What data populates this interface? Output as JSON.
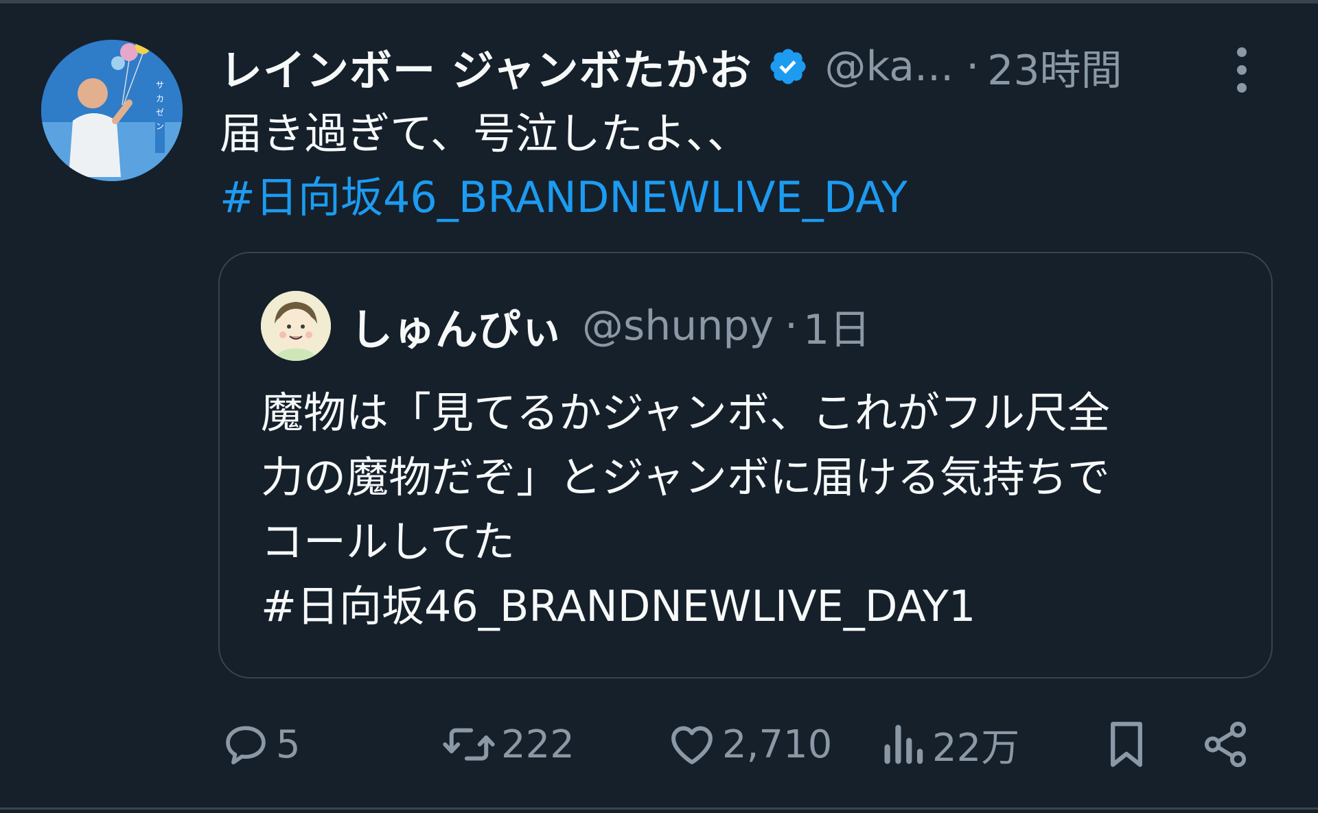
{
  "tweet": {
    "author": {
      "display_name": "レインボー ジャンボたかお",
      "handle": "@ka...",
      "verified": true,
      "avatar_icon": "profile-photo"
    },
    "separator": "·",
    "time": "23時間",
    "text": "届き過ぎて、号泣したよ、、",
    "hashtag": "#日向坂46_BRANDNEWLIVE_DAY"
  },
  "quote": {
    "author": {
      "display_name": "しゅんぴぃ",
      "handle": "@shunpy",
      "avatar_icon": "cartoon-avatar"
    },
    "separator": "·",
    "time": "1日",
    "lines": [
      "魔物は「見てるかジャンボ、これがフル尺全",
      "力の魔物だぞ」とジャンボに届ける気持ちで",
      "コールしてた",
      "#日向坂46_BRANDNEWLIVE_DAY1"
    ]
  },
  "actions": {
    "reply_count": "5",
    "retweet_count": "222",
    "like_count": "2,710",
    "views_count": "22万"
  },
  "colors": {
    "background": "#15202b",
    "text": "#f7f9f9",
    "secondary": "#8b98a5",
    "link": "#1d9bf0",
    "border": "#38444d"
  }
}
